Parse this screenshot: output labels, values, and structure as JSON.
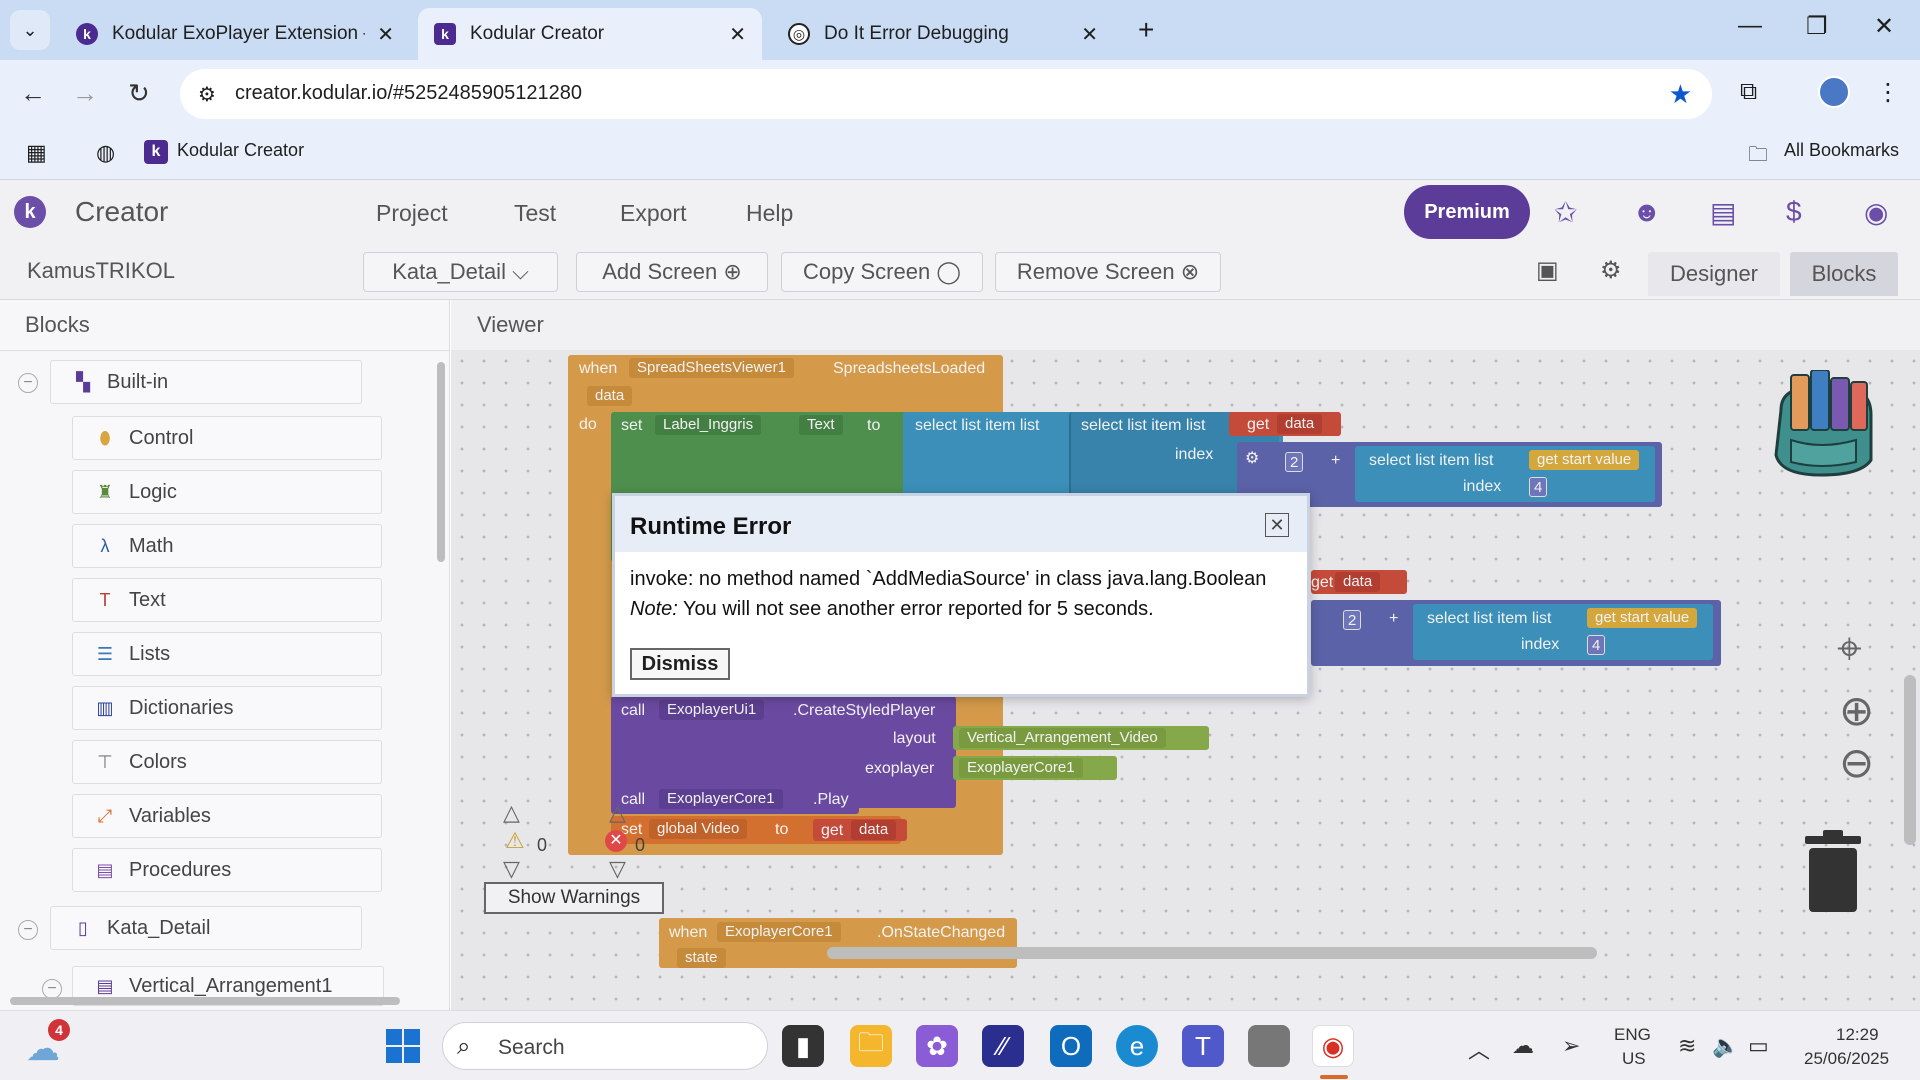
{
  "browser": {
    "tabs": [
      {
        "title": "Kodular ExoPlayer Extension –",
        "active": false
      },
      {
        "title": "Kodular Creator",
        "active": true
      },
      {
        "title": "Do It Error Debugging",
        "active": false
      }
    ],
    "url": "creator.kodular.io/#5252485905121280",
    "bookmarks": {
      "item": "Kodular Creator",
      "all": "All Bookmarks"
    }
  },
  "app": {
    "brand": "Creator",
    "menu": [
      "Project",
      "Test",
      "Export",
      "Help"
    ],
    "premium": "Premium",
    "project_name": "KamusTRIKOL",
    "screen_select": "Kata_Detail",
    "add_screen": "Add Screen",
    "copy_screen": "Copy Screen",
    "remove_screen": "Remove Screen",
    "designer": "Designer",
    "blocks": "Blocks"
  },
  "blocks_panel": {
    "title": "Blocks",
    "builtin": "Built-in",
    "items": [
      "Control",
      "Logic",
      "Math",
      "Text",
      "Lists",
      "Dictionaries",
      "Colors",
      "Variables",
      "Procedures"
    ],
    "screen": "Kata_Detail",
    "child": "Vertical_Arrangement1"
  },
  "viewer": {
    "title": "Viewer",
    "warnings_count": "0",
    "errors_count": "0",
    "show_warnings": "Show Warnings"
  },
  "code_blocks": {
    "when": "when",
    "event_component": "SpreadSheetsViewer1",
    "event_name": "SpreadsheetsLoaded",
    "param": "data",
    "do": "do",
    "set": "set",
    "label": "Label_Inggris",
    "text_prop": "Text",
    "to": "to",
    "select_list_item": "select list item",
    "list": "list",
    "index": "index",
    "get": "get",
    "data": "data",
    "num2": "2",
    "plus": "+",
    "get_start_value": "get start value",
    "num4": "4",
    "call": "call",
    "exo_ui": "ExoplayerUi1",
    "create_styled": ".CreateStyledPlayer",
    "layout": "layout",
    "layout_val": "Vertical_Arrangement_Video",
    "exoplayer": "exoplayer",
    "exo_core": "ExoplayerCore1",
    "play": ".Play",
    "global_video": "global Video",
    "on_state": ".OnStateChanged",
    "state": "state"
  },
  "dialog": {
    "title": "Runtime Error",
    "message": "invoke: no method named `AddMediaSource' in class java.lang.Boolean",
    "note_label": "Note:",
    "note_text": " You will not see another error reported for 5 seconds.",
    "dismiss": "Dismiss"
  },
  "taskbar": {
    "search": "Search",
    "weather_badge": "4",
    "lang": "ENG",
    "region": "US",
    "time": "12:29",
    "date": "25/06/2025"
  }
}
